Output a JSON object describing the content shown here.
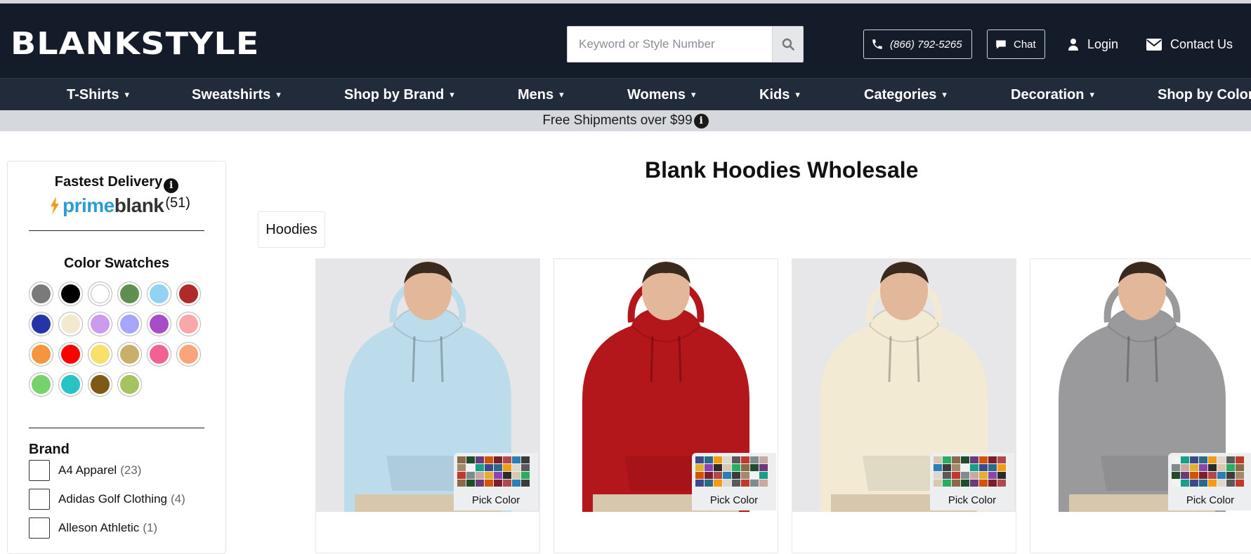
{
  "header": {
    "logo": "BLANKSTYLE",
    "search_placeholder": "Keyword or Style Number",
    "phone": "(866) 792-5265",
    "chat": "Chat",
    "login": "Login",
    "contact": "Contact Us"
  },
  "nav": {
    "items": [
      "T-Shirts",
      "Sweatshirts",
      "Shop by Brand",
      "Mens",
      "Womens",
      "Kids",
      "Categories",
      "Decoration",
      "Shop by Color"
    ],
    "caret": "▾"
  },
  "banner": {
    "text": "Free Shipments over $99",
    "info": "i"
  },
  "sidebar": {
    "fastest_delivery": "Fastest Delivery",
    "info": "i",
    "prime_part1": "prime",
    "prime_part2": "blank",
    "prime_count": "(51)",
    "color_swatches_title": "Color Swatches",
    "swatches": [
      "#7a7a7a",
      "#000000",
      "#ffffff",
      "#5e8f4f",
      "#92d2f2",
      "#b02a2a",
      "#2535a8",
      "#f1ead0",
      "#c99cf0",
      "#a7a5ff",
      "#a64dc7",
      "#f8a8a8",
      "#f5953d",
      "#ff0000",
      "#f8e06a",
      "#c8b06c",
      "#f06292",
      "#f9a47a",
      "#76d26a",
      "#29c3c3",
      "#7f5a17",
      "#a5c460"
    ],
    "brand_title": "Brand",
    "brands": [
      {
        "name": "A4 Apparel",
        "count": "(23)"
      },
      {
        "name": "Adidas Golf Clothing",
        "count": "(4)"
      },
      {
        "name": "Alleson Athletic",
        "count": "(1)"
      }
    ]
  },
  "main": {
    "title": "Blank Hoodies Wholesale",
    "chip": "Hoodies",
    "products": [
      {
        "hoodie_color": "#bcdcec",
        "bg": "#e6e6e8",
        "pick_label": "Pick Color"
      },
      {
        "hoodie_color": "#b3161b",
        "bg": "#ffffff",
        "pick_label": "Pick Color"
      },
      {
        "hoodie_color": "#f2ead3",
        "bg": "#e7e6e8",
        "pick_label": "Pick Color"
      },
      {
        "hoodie_color": "#9a9a9c",
        "bg": "#ffffff",
        "pick_label": "Pick Color"
      }
    ]
  }
}
